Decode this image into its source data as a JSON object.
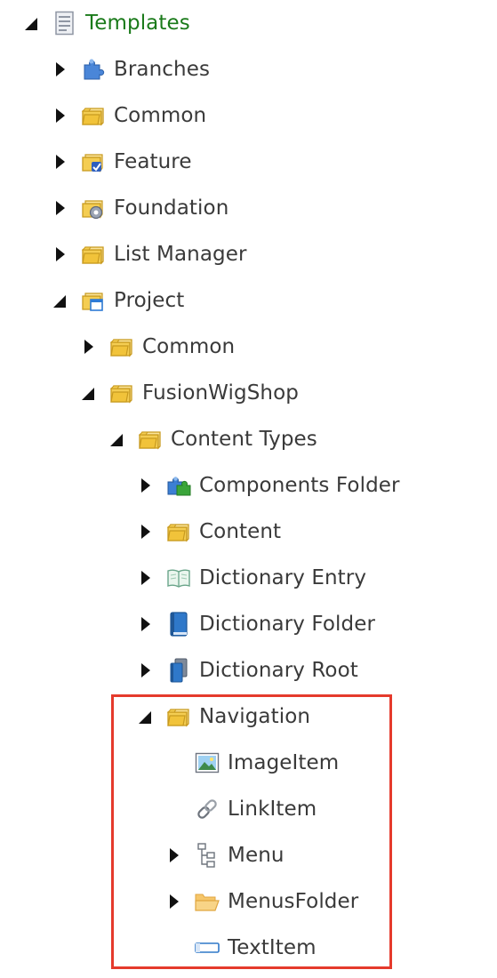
{
  "tree": {
    "items": [
      {
        "label": "Templates",
        "icon": "template-document-icon",
        "expander": "expanded",
        "depth": 0,
        "color": "#1a7a1a"
      },
      {
        "label": "Branches",
        "icon": "branches-puzzle-icon",
        "expander": "collapsed",
        "depth": 1
      },
      {
        "label": "Common",
        "icon": "folder-icon",
        "expander": "collapsed",
        "depth": 1
      },
      {
        "label": "Feature",
        "icon": "feature-folder-icon",
        "expander": "collapsed",
        "depth": 1
      },
      {
        "label": "Foundation",
        "icon": "foundation-folder-icon",
        "expander": "collapsed",
        "depth": 1
      },
      {
        "label": "List Manager",
        "icon": "folder-icon",
        "expander": "collapsed",
        "depth": 1
      },
      {
        "label": "Project",
        "icon": "project-folder-icon",
        "expander": "expanded",
        "depth": 1
      },
      {
        "label": "Common",
        "icon": "folder-icon",
        "expander": "collapsed",
        "depth": 2
      },
      {
        "label": "FusionWigShop",
        "icon": "folder-icon",
        "expander": "expanded",
        "depth": 2
      },
      {
        "label": "Content Types",
        "icon": "folder-icon",
        "expander": "expanded",
        "depth": 3
      },
      {
        "label": "Components Folder",
        "icon": "components-puzzle-icon",
        "expander": "collapsed",
        "depth": 4
      },
      {
        "label": "Content",
        "icon": "folder-icon",
        "expander": "collapsed",
        "depth": 4
      },
      {
        "label": "Dictionary Entry",
        "icon": "open-book-icon",
        "expander": "collapsed",
        "depth": 4
      },
      {
        "label": "Dictionary Folder",
        "icon": "blue-book-icon",
        "expander": "collapsed",
        "depth": 4
      },
      {
        "label": "Dictionary Root",
        "icon": "book-stack-icon",
        "expander": "collapsed",
        "depth": 4
      },
      {
        "label": "Navigation",
        "icon": "folder-icon",
        "expander": "expanded",
        "depth": 4
      },
      {
        "label": "ImageItem",
        "icon": "image-icon",
        "expander": "none",
        "depth": 5
      },
      {
        "label": "LinkItem",
        "icon": "link-chain-icon",
        "expander": "none",
        "depth": 5
      },
      {
        "label": "Menu",
        "icon": "hierarchy-icon",
        "expander": "collapsed",
        "depth": 5
      },
      {
        "label": "MenusFolder",
        "icon": "open-folder-icon",
        "expander": "collapsed",
        "depth": 5
      },
      {
        "label": "TextItem",
        "icon": "text-field-icon",
        "expander": "none",
        "depth": 5
      }
    ]
  },
  "highlight": {
    "color": "#e53a2c"
  }
}
